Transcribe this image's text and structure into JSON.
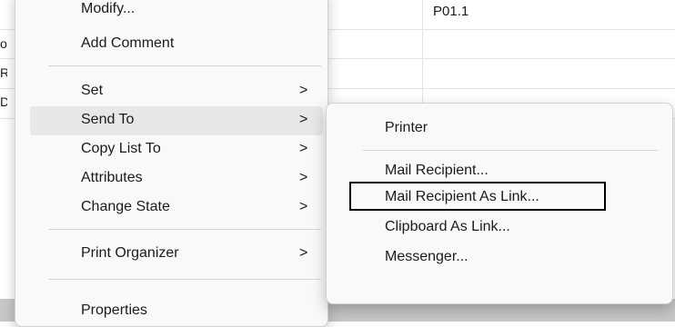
{
  "background": {
    "cell_text": "P01.1",
    "edge_chars": [
      "o",
      "R",
      "D"
    ]
  },
  "menu": {
    "items": [
      {
        "label": "Modify...",
        "arrow": ""
      },
      {
        "label": "Add Comment",
        "arrow": ""
      },
      {
        "label": "Set",
        "arrow": ">"
      },
      {
        "label": "Send To",
        "arrow": ">"
      },
      {
        "label": "Copy List To",
        "arrow": ">"
      },
      {
        "label": "Attributes",
        "arrow": ">"
      },
      {
        "label": "Change State",
        "arrow": ">"
      },
      {
        "label": "Print Organizer",
        "arrow": ">"
      },
      {
        "label": "Properties",
        "arrow": ""
      }
    ],
    "active_item": "Send To"
  },
  "submenu": {
    "items": [
      {
        "label": "Printer"
      },
      {
        "label": "Mail Recipient..."
      },
      {
        "label": "Mail Recipient As Link..."
      },
      {
        "label": "Clipboard As Link..."
      },
      {
        "label": "Messenger..."
      }
    ],
    "highlighted_item": "Mail Recipient As Link..."
  }
}
